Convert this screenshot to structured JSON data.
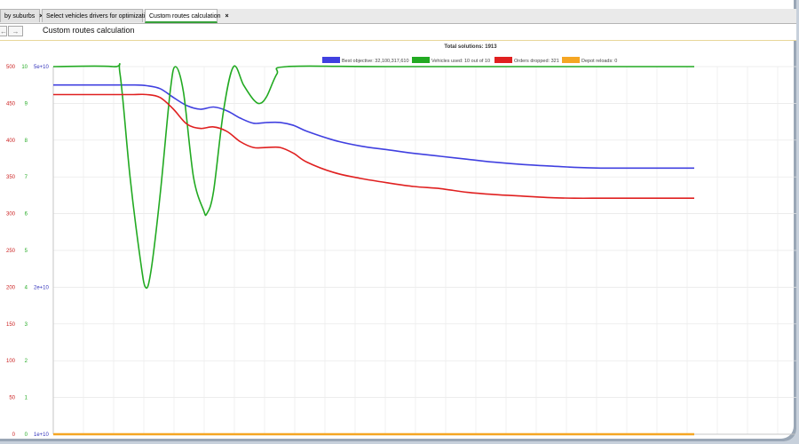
{
  "tabs": [
    {
      "label": "by suburbs",
      "close": "×"
    },
    {
      "label": "Select vehicles drivers for optimization",
      "close": "×"
    },
    {
      "label": "Custom routes calculation",
      "close": "×"
    }
  ],
  "nav": {
    "back": "←",
    "forward": "→"
  },
  "page_title": "Custom routes calculation",
  "chart_data": {
    "type": "line",
    "title": "Total solutions: 1913",
    "legend": [
      {
        "name": "Best objective: 32,100,317,610",
        "color": "#4040e0"
      },
      {
        "name": "Vehicles used: 10 out of 10",
        "color": "#22aa22"
      },
      {
        "name": "Orders dropped: 321",
        "color": "#e02020"
      },
      {
        "name": "Depot reloads: 0",
        "color": "#f5a623"
      }
    ],
    "axes": {
      "orders": {
        "ticks": [
          "0",
          "50",
          "100",
          "150",
          "200",
          "250",
          "300",
          "350",
          "400",
          "450",
          "500"
        ],
        "range": [
          0,
          500
        ],
        "color": "#cc2222"
      },
      "vehicles": {
        "ticks": [
          "0",
          "1",
          "2",
          "3",
          "4",
          "5",
          "6",
          "7",
          "8",
          "9",
          "10"
        ],
        "range": [
          0,
          10
        ],
        "color": "#22aa22"
      },
      "objective": {
        "ticks": [
          "1e+10",
          "2e+10",
          "5e+10"
        ],
        "color": "#3333bb"
      }
    },
    "x_range": [
      0,
      100
    ],
    "series": [
      {
        "name": "Best objective",
        "color": "#4040e0",
        "axis": "orders",
        "points": [
          [
            0,
            475
          ],
          [
            9,
            475
          ],
          [
            12,
            475
          ],
          [
            14,
            474
          ],
          [
            16,
            470
          ],
          [
            18,
            458
          ],
          [
            20,
            447
          ],
          [
            22,
            442
          ],
          [
            24,
            445
          ],
          [
            26,
            440
          ],
          [
            28,
            430
          ],
          [
            30,
            423
          ],
          [
            32,
            424
          ],
          [
            34,
            424
          ],
          [
            36,
            420
          ],
          [
            38,
            412
          ],
          [
            42,
            400
          ],
          [
            46,
            392
          ],
          [
            50,
            387
          ],
          [
            54,
            382
          ],
          [
            58,
            378
          ],
          [
            62,
            374
          ],
          [
            66,
            370
          ],
          [
            70,
            367
          ],
          [
            74,
            365
          ],
          [
            78,
            363
          ],
          [
            82,
            362
          ],
          [
            86,
            362
          ],
          [
            90,
            362
          ],
          [
            96,
            362
          ]
        ]
      },
      {
        "name": "Vehicles used",
        "color": "#22aa22",
        "axis": "vehicles",
        "points": [
          [
            0,
            10
          ],
          [
            9,
            10
          ],
          [
            10,
            9.8
          ],
          [
            11.5,
            7
          ],
          [
            13,
            4.8
          ],
          [
            13.8,
            4
          ],
          [
            14.6,
            4.4
          ],
          [
            16,
            6.5
          ],
          [
            17.5,
            9.3
          ],
          [
            18.3,
            10
          ],
          [
            19.5,
            9.3
          ],
          [
            21,
            7
          ],
          [
            22.5,
            6.1
          ],
          [
            23,
            6
          ],
          [
            24,
            6.6
          ],
          [
            25.5,
            8.8
          ],
          [
            27,
            10
          ],
          [
            28.5,
            9.5
          ],
          [
            30,
            9.1
          ],
          [
            31,
            9
          ],
          [
            32,
            9.2
          ],
          [
            33.5,
            9.8
          ],
          [
            35,
            10
          ],
          [
            50,
            10
          ],
          [
            96,
            10
          ]
        ]
      },
      {
        "name": "Orders dropped",
        "color": "#e02020",
        "axis": "orders",
        "points": [
          [
            0,
            462
          ],
          [
            9,
            462
          ],
          [
            12,
            462
          ],
          [
            14,
            462
          ],
          [
            16,
            458
          ],
          [
            18,
            442
          ],
          [
            20,
            422
          ],
          [
            22,
            416
          ],
          [
            24,
            418
          ],
          [
            26,
            412
          ],
          [
            28,
            398
          ],
          [
            30,
            390
          ],
          [
            32,
            390
          ],
          [
            34,
            390
          ],
          [
            36,
            382
          ],
          [
            38,
            370
          ],
          [
            42,
            356
          ],
          [
            46,
            348
          ],
          [
            50,
            342
          ],
          [
            54,
            337
          ],
          [
            58,
            334
          ],
          [
            62,
            329
          ],
          [
            66,
            326
          ],
          [
            70,
            324
          ],
          [
            74,
            322
          ],
          [
            78,
            321
          ],
          [
            82,
            321
          ],
          [
            86,
            321
          ],
          [
            90,
            321
          ],
          [
            96,
            321
          ]
        ]
      },
      {
        "name": "Depot reloads",
        "color": "#f5a623",
        "axis": "orders",
        "points": [
          [
            0,
            0
          ],
          [
            96,
            0
          ]
        ]
      }
    ],
    "grid": true
  }
}
